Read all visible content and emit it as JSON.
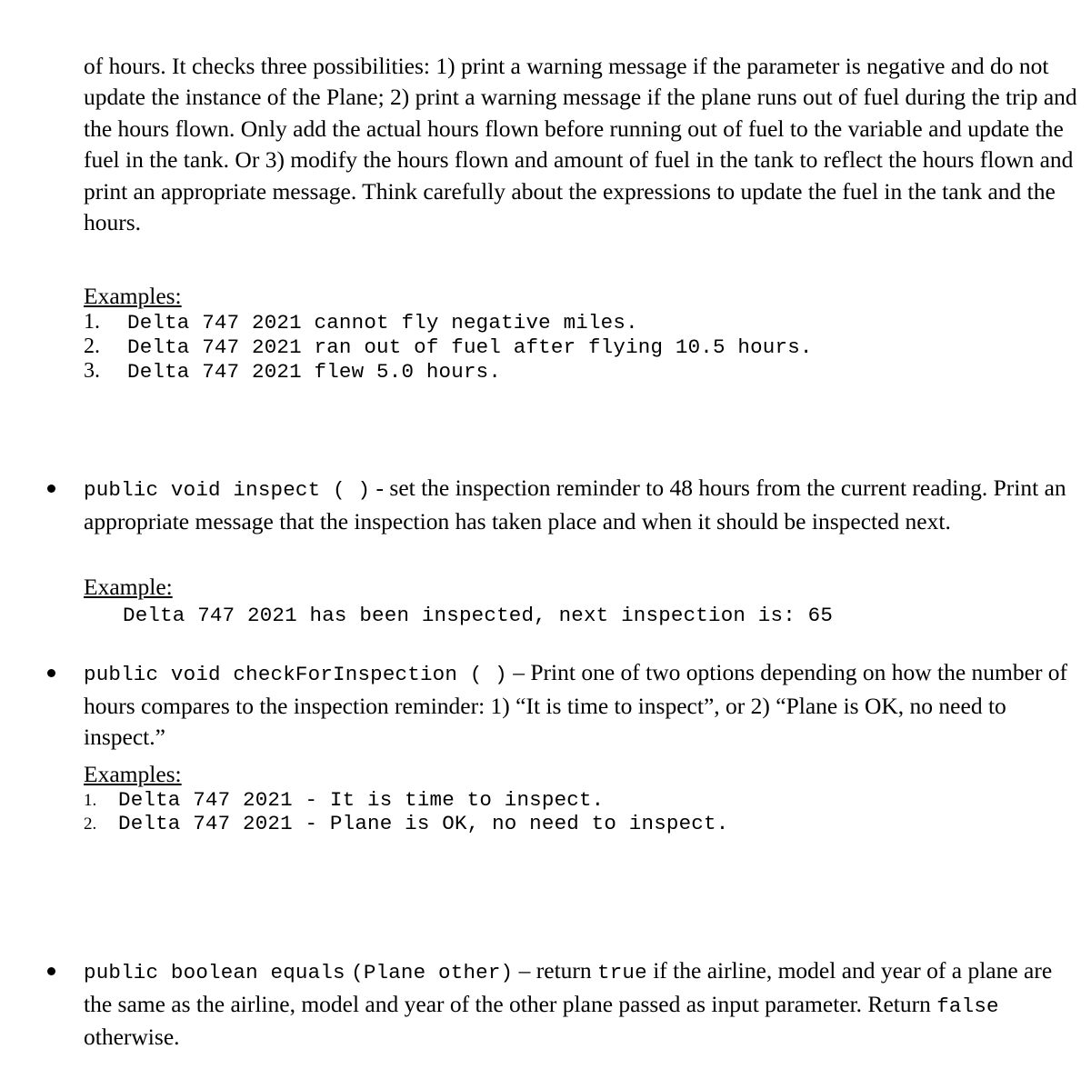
{
  "document": {
    "type": "assignment-specification",
    "background_color": "#ffffff",
    "text_color": "#000000"
  },
  "intro_paragraph": {
    "text": "of hours.  It checks three possibilities: 1) print a warning message if the parameter is negative and do not update the instance of the Plane; 2) print a warning message if the plane runs out of fuel during the trip and the hours flown.  Only add the actual hours flown before running out of fuel to the variable and update the fuel in the tank. Or 3) modify the hours flown and amount of fuel in the tank to reflect the hours flown and print an appropriate message. Think carefully about the expressions to update the fuel in the tank and the hours."
  },
  "examples_block_1": {
    "heading": "Examples:",
    "items": [
      {
        "number": "1.",
        "text": "Delta 747 2021 cannot fly negative miles."
      },
      {
        "number": "2.",
        "text": "Delta 747 2021 ran out of fuel after flying 10.5 hours."
      },
      {
        "number": "3.",
        "text": "Delta 747 2021 flew 5.0 hours."
      }
    ]
  },
  "bullet_inspect": {
    "signature": "public void inspect ( )",
    "description": " - set the inspection reminder to 48 hours from the current reading. Print an appropriate message that the inspection has taken place and when it should be inspected next.",
    "example_heading": "Example:",
    "example_line": "Delta 747 2021 has been inspected, next inspection is: 65"
  },
  "bullet_checkforinspection": {
    "signature": "public void checkForInspection ( )",
    "description_part_1": " – Print one of two options depending on how the number of hours compares to the inspection reminder: 1) “It is time to inspect”, or 2) “Plane is OK, no need to inspect.”",
    "examples_heading": "Examples:",
    "examples": [
      {
        "number": "1.",
        "text": "Delta 747 2021 - It is time to inspect."
      },
      {
        "number": "2.",
        "text": "Delta 747 2021 - Plane is OK, no need to inspect."
      }
    ]
  },
  "bullet_equals": {
    "signature_part_1": "public boolean equals",
    "signature_part_2": "(Plane other)",
    "dash_return": " – return ",
    "true_literal": "true",
    "description_part_1": " if the airline, model and year of a plane are the same as the airline, model and year of the other plane passed as input parameter. Return ",
    "false_literal": "false",
    "description_part_2": " otherwise."
  }
}
